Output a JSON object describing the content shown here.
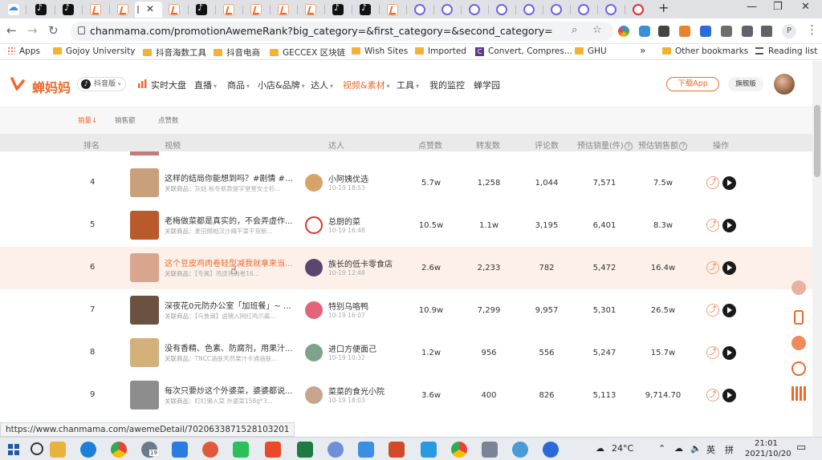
{
  "tabs": {
    "active_close": "✕"
  },
  "window": {
    "minimize": "—",
    "restore": "❐",
    "close": "✕",
    "new_tab": "+"
  },
  "toolbar": {
    "url": "chanmama.com/promotionAwemeRank?big_category=&first_category=&second_category=",
    "back": "←",
    "forward": "→",
    "reload": "↻",
    "zoom_icon": "⌕",
    "star_icon": "☆",
    "profile": "P"
  },
  "bookmarks": {
    "items": [
      "Apps",
      "Gojoy University",
      "抖音海数工具",
      "抖音电商",
      "GECCEX 区块链",
      "Wish Sites",
      "Imported",
      "Convert, Compres...",
      "GHU"
    ],
    "more": "»",
    "other": "Other bookmarks",
    "reading": "Reading list"
  },
  "site": {
    "logo": "蝉妈妈",
    "platform": "抖音版",
    "menu": [
      "实时大盘",
      "直播",
      "商品",
      "小店&品牌",
      "达人",
      "视频&素材",
      "工具",
      "我的监控",
      "蝉学园"
    ],
    "active_menu": "视频&素材",
    "download": "下载App",
    "vip": "旗舰版"
  },
  "sort_tabs": [
    "销量↓",
    "销售额",
    "点赞数"
  ],
  "table": {
    "headers": [
      "排名",
      "视频",
      "达人",
      "点赞数",
      "转发数",
      "评论数",
      "预估销量(件)",
      "预估销售额",
      "操作"
    ],
    "rows": [
      {
        "rank": "4",
        "title": "这样的结局你能想到吗？#剧情 #搞...",
        "sub_label": "关联商品：",
        "sub": "灰姑 秋冬新款提字堂堂女士衫...",
        "kol": "小阿姨优选",
        "date": "10-19 18:53",
        "likes": "5.7w",
        "shares": "1,258",
        "comments": "1,044",
        "sales": "7,571",
        "revenue": "7.5w",
        "thumb_color": "#c9a07c",
        "avatar_color": "#d6a36b",
        "highlight": false
      },
      {
        "rank": "5",
        "title": "老梅做菜都是真实的，不会弄虚作...",
        "sub_label": "关联商品：",
        "sub": "麦田照相汉沙梅干菜干货新...",
        "kol": "总厨的菜",
        "date": "10-19 16:48",
        "likes": "10.5w",
        "shares": "1.1w",
        "comments": "3,195",
        "sales": "6,401",
        "revenue": "8.3w",
        "thumb_color": "#b85a2c",
        "avatar_color": "#ffffff",
        "highlight": false
      },
      {
        "rank": "6",
        "title": "这个豆皮鸡肉卷轻型减我就拿来当...",
        "sub_label": "关联商品：",
        "sub": "【专属】鸡皮鸡肉卷16...",
        "kol": "族长的低卡零食店",
        "date": "10-19 12:48",
        "likes": "2.6w",
        "shares": "2,233",
        "comments": "782",
        "sales": "5,472",
        "revenue": "16.4w",
        "thumb_color": "#d8a58f",
        "avatar_color": "#5a4670",
        "highlight": true
      },
      {
        "rank": "7",
        "title": "深夜花0元防办公室「加班餐」~ 加...",
        "sub_label": "关联商品：",
        "sub": "【乌鲁闽】卤猪入网红鸡爪酱...",
        "kol": "特别乌咯鸭",
        "date": "10-19 16:07",
        "likes": "10.9w",
        "shares": "7,299",
        "comments": "9,957",
        "sales": "5,301",
        "revenue": "26.5w",
        "thumb_color": "#6b5240",
        "avatar_color": "#e0657a",
        "highlight": false
      },
      {
        "rank": "8",
        "title": "没有香精、色素、防腐剂，用果汁...",
        "sub_label": "关联商品：",
        "sub": "TNCC涵肤天然果汁卡通涵肤...",
        "kol": "进口方便面己",
        "date": "10-19 10:32",
        "likes": "1.2w",
        "shares": "956",
        "comments": "556",
        "sales": "5,247",
        "revenue": "15.7w",
        "thumb_color": "#d4b07a",
        "avatar_color": "#7fa38a",
        "highlight": false
      },
      {
        "rank": "9",
        "title": "每次只要炒这个外婆菜，婆婆都说...",
        "sub_label": "关联商品：",
        "sub": "盯盯懒人菜 外婆菜158g*3...",
        "kol": "菜菜的食光小院",
        "date": "10-19 18:03",
        "likes": "3.6w",
        "shares": "400",
        "comments": "826",
        "sales": "5,113",
        "revenue": "9,714.70",
        "thumb_color": "#8d8d8d",
        "avatar_color": "#caa58d",
        "highlight": false
      }
    ]
  },
  "status_url": "https://www.chanmama.com/awemeDetail/7020633871528103201",
  "taskbar": {
    "weather": "24°C",
    "lang": "英",
    "ime": "拼",
    "time": "21:01",
    "date": "2021/10/20",
    "badge": "19"
  }
}
